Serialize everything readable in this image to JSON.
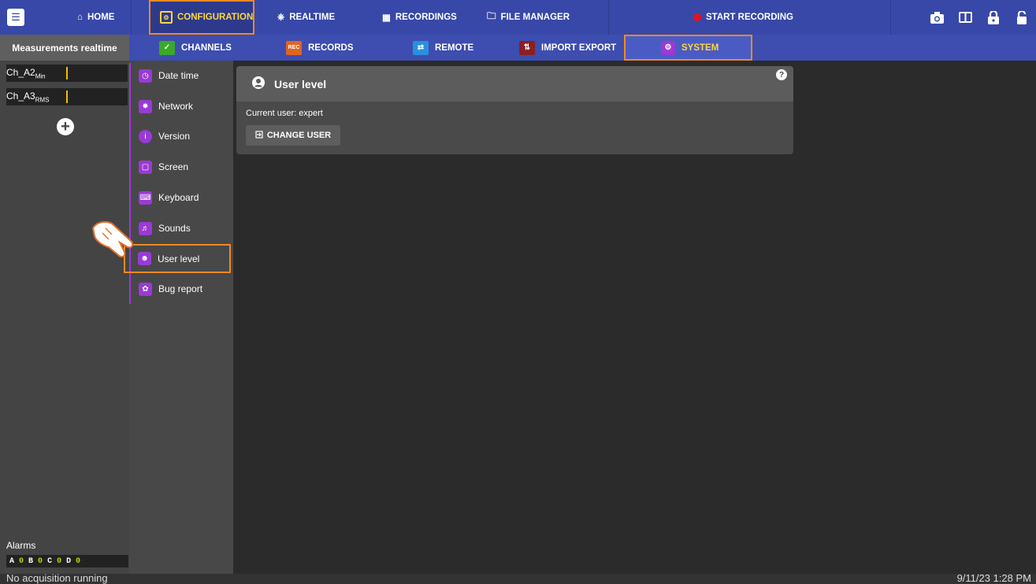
{
  "topbar": {
    "home_label": "HOME",
    "configuration_label": "CONFIGURATION",
    "realtime_label": "REALTIME",
    "recordings_label": "RECORDINGS",
    "file_manager_label": "FILE MANAGER",
    "start_recording_label": "START RECORDING"
  },
  "sidebar": {
    "title": "Measurements realtime",
    "channels": [
      {
        "name": "Ch_A2",
        "sub": "Min"
      },
      {
        "name": "Ch_A3",
        "sub": "RMS"
      }
    ],
    "alarms_label": "Alarms",
    "alarms": [
      {
        "letter": "A",
        "value": "0"
      },
      {
        "letter": "B",
        "value": "0"
      },
      {
        "letter": "C",
        "value": "0"
      },
      {
        "letter": "D",
        "value": "0"
      }
    ]
  },
  "subtabs": {
    "channels": "CHANNELS",
    "records": "RECORDS",
    "remote": "REMOTE",
    "import_export": "IMPORT EXPORT",
    "system": "SYSTEM"
  },
  "menu": {
    "items": [
      {
        "label": "Date time",
        "icon": "clock-icon"
      },
      {
        "label": "Network",
        "icon": "network-icon"
      },
      {
        "label": "Version",
        "icon": "info-icon"
      },
      {
        "label": "Screen",
        "icon": "monitor-icon"
      },
      {
        "label": "Keyboard",
        "icon": "keyboard-icon"
      },
      {
        "label": "Sounds",
        "icon": "speaker-icon"
      },
      {
        "label": "User level",
        "icon": "user-circle-icon"
      },
      {
        "label": "Bug report",
        "icon": "bug-icon"
      }
    ]
  },
  "panel": {
    "title": "User level",
    "current_user_text": "Current user: expert",
    "change_user_label": "CHANGE USER"
  },
  "status": {
    "left": "No acquisition running",
    "right": "9/11/23 1:28 PM"
  },
  "colors": {
    "topbar": "#3848a8",
    "accent_highlight": "#f08a24",
    "selected_text": "#ffd640",
    "menu_accent": "#9a3ad6",
    "record_dot": "#e0141e"
  }
}
